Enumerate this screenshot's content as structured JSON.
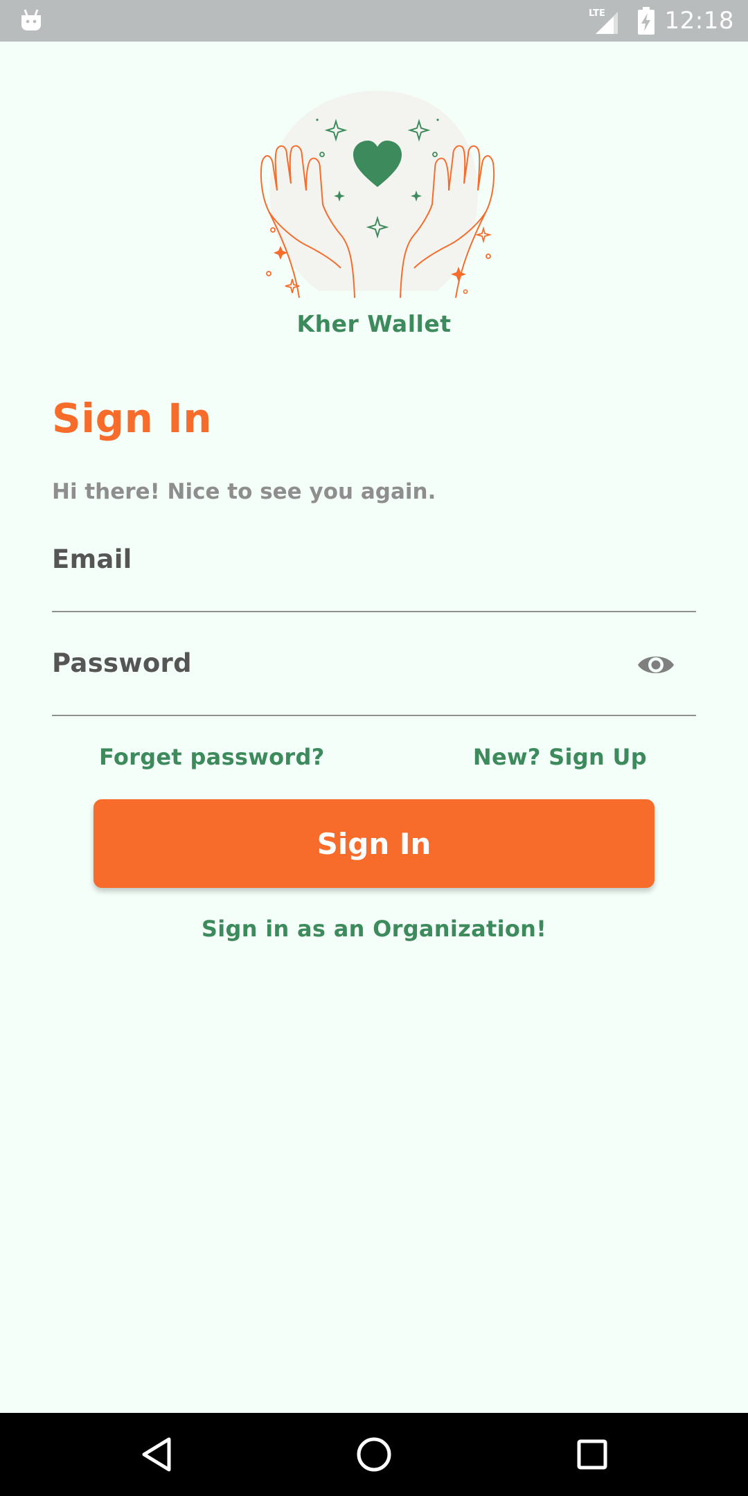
{
  "status_bar": {
    "network": "LTE",
    "time": "12:18",
    "icons": [
      "android-icon",
      "lte-signal-icon",
      "battery-charging-icon"
    ]
  },
  "app": {
    "name": "Kher Wallet",
    "logo_icon": "hands-heart-icon"
  },
  "sign_in": {
    "heading": "Sign In",
    "subtitle": "Hi there! Nice to see you again.",
    "email_label": "Email",
    "email_value": "",
    "password_label": "Password",
    "password_value": "",
    "forget_password": "Forget password?",
    "sign_up": "New? Sign Up",
    "button_label": "Sign In",
    "organization_link": "Sign in as an Organization!"
  },
  "nav_bar": {
    "back": "back-icon",
    "home": "home-icon",
    "recents": "recents-icon"
  },
  "colors": {
    "background": "#f5fff9",
    "accent_orange": "#f76b2b",
    "accent_green": "#3d8a5c",
    "text_gray": "#8e8e8e",
    "label_gray": "#555555",
    "status_bar": "#b8bcbc"
  }
}
